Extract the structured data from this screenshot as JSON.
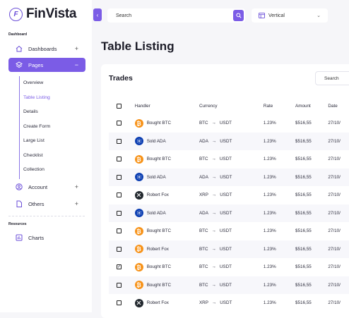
{
  "app": {
    "name": "FinVista"
  },
  "sidebar": {
    "section_dashboard": "Dashboard",
    "section_resources": "Resources",
    "items": [
      {
        "label": "Dashboards",
        "toggle": "+"
      },
      {
        "label": "Pages",
        "toggle": "−"
      },
      {
        "label": "Account",
        "toggle": "+"
      },
      {
        "label": "Others",
        "toggle": "+"
      },
      {
        "label": "Charts"
      }
    ],
    "subitems": [
      "Overview",
      "Table Listing",
      "Details",
      "Create Form",
      "Large List",
      "Checklist",
      "Collection"
    ]
  },
  "header": {
    "search_placeholder": "Search",
    "layout_select": "Vertical"
  },
  "main": {
    "title": "Table Listing",
    "card_title": "Trades",
    "card_search": "Search"
  },
  "table": {
    "headers": [
      "Handler",
      "Currency",
      "Rate",
      "Amount",
      "Date"
    ],
    "rows": [
      {
        "checked": false,
        "coin": "btc",
        "handler": "Bought BTC",
        "from": "BTC",
        "to": "USDT",
        "rate": "1.23%",
        "amount": "$516,55",
        "date": "27/10/"
      },
      {
        "checked": false,
        "coin": "ada",
        "handler": "Sold ADA",
        "from": "ADA",
        "to": "USDT",
        "rate": "1.23%",
        "amount": "$516,55",
        "date": "27/10/"
      },
      {
        "checked": false,
        "coin": "btc",
        "handler": "Bought BTC",
        "from": "BTC",
        "to": "USDT",
        "rate": "1.23%",
        "amount": "$516,55",
        "date": "27/10/"
      },
      {
        "checked": false,
        "coin": "ada",
        "handler": "Sold ADA",
        "from": "ADA",
        "to": "USDT",
        "rate": "1.23%",
        "amount": "$516,55",
        "date": "27/10/"
      },
      {
        "checked": false,
        "coin": "xrp",
        "handler": "Robert Fox",
        "from": "XRP",
        "to": "USDT",
        "rate": "1.23%",
        "amount": "$516,55",
        "date": "27/10/"
      },
      {
        "checked": false,
        "coin": "ada",
        "handler": "Sold ADA",
        "from": "ADA",
        "to": "USDT",
        "rate": "1.23%",
        "amount": "$516,55",
        "date": "27/10/"
      },
      {
        "checked": false,
        "coin": "btc",
        "handler": "Bought BTC",
        "from": "BTC",
        "to": "USDT",
        "rate": "1.23%",
        "amount": "$516,55",
        "date": "27/10/"
      },
      {
        "checked": false,
        "coin": "btc",
        "handler": "Robert Fox",
        "from": "BTC",
        "to": "USDT",
        "rate": "1.23%",
        "amount": "$516,55",
        "date": "27/10/"
      },
      {
        "checked": true,
        "coin": "btc",
        "handler": "Bought BTC",
        "from": "BTC",
        "to": "USDT",
        "rate": "1.23%",
        "amount": "$516,55",
        "date": "27/10/"
      },
      {
        "checked": false,
        "coin": "btc",
        "handler": "Bought BTC",
        "from": "BTC",
        "to": "USDT",
        "rate": "1.23%",
        "amount": "$516,55",
        "date": "27/10/"
      },
      {
        "checked": false,
        "coin": "xrp",
        "handler": "Robert Fox",
        "from": "XRP",
        "to": "USDT",
        "rate": "1.23%",
        "amount": "$516,55",
        "date": "27/10/"
      }
    ]
  },
  "colors": {
    "accent": "#7b5ce6",
    "btc": "#f7931a",
    "ada": "#0d3fb2",
    "xrp": "#23292f"
  },
  "icons": {
    "btc": "bitcoin-icon",
    "ada": "cardano-icon",
    "xrp": "ripple-icon"
  }
}
